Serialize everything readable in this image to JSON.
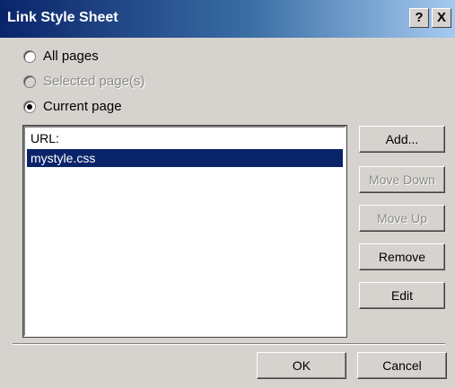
{
  "window": {
    "title": "Link Style Sheet",
    "help_glyph": "?",
    "close_glyph": "X"
  },
  "scope_options": [
    {
      "label": "All pages",
      "checked": false,
      "enabled": true
    },
    {
      "label": "Selected page(s)",
      "checked": false,
      "enabled": false
    },
    {
      "label": "Current page",
      "checked": true,
      "enabled": true
    }
  ],
  "url_list": {
    "header": "URL:",
    "items": [
      "mystyle.css"
    ],
    "selected_index": 0
  },
  "side_buttons": {
    "add": "Add...",
    "move_down": "Move Down",
    "move_up": "Move Up",
    "remove": "Remove",
    "edit": "Edit"
  },
  "footer_buttons": {
    "ok": "OK",
    "cancel": "Cancel"
  },
  "colors": {
    "title_gradient_start": "#0a246a",
    "title_gradient_end": "#a6caf0",
    "selection": "#0a246a",
    "dialog_face": "#d6d3ce"
  }
}
